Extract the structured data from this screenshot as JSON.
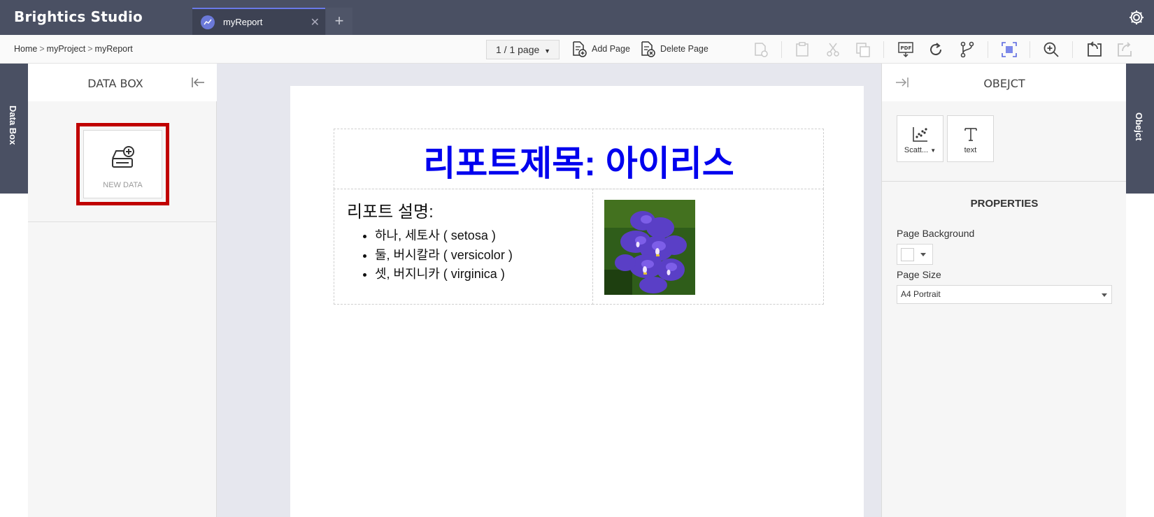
{
  "app": {
    "title": "Brightics Studio"
  },
  "tabs": [
    {
      "label": "myReport",
      "icon": "chart-line-icon"
    }
  ],
  "breadcrumb": {
    "home": "Home",
    "project": "myProject",
    "report": "myReport"
  },
  "toolbar": {
    "page_selector": "1 / 1 page",
    "add_page": "Add Page",
    "delete_page": "Delete Page"
  },
  "side_tabs": {
    "left": "Data Box",
    "right": "Obejct"
  },
  "data_box": {
    "title": "DATA BOX",
    "new_data": "NEW DATA"
  },
  "report": {
    "title": "리포트제목: 아이리스",
    "description_heading": "리포트 설명:",
    "items": [
      "하나, 세토사 ( setosa )",
      "둘, 버시칼라 ( versicolor )",
      "셋, 버지니카 ( virginica )"
    ],
    "title_color": "#0000ee"
  },
  "object_panel": {
    "title": "OBEJCT",
    "objects": [
      {
        "label": "Scatt...",
        "icon": "scatter-plot-icon"
      },
      {
        "label": "text",
        "icon": "text-icon"
      }
    ],
    "properties_title": "PROPERTIES",
    "page_background_label": "Page Background",
    "page_background_value": "#ffffff",
    "page_size_label": "Page Size",
    "page_size_value": "A4 Portrait"
  },
  "colors": {
    "header_bg": "#4a5063",
    "accent": "#6a79e8",
    "highlight_border": "#c00000"
  }
}
